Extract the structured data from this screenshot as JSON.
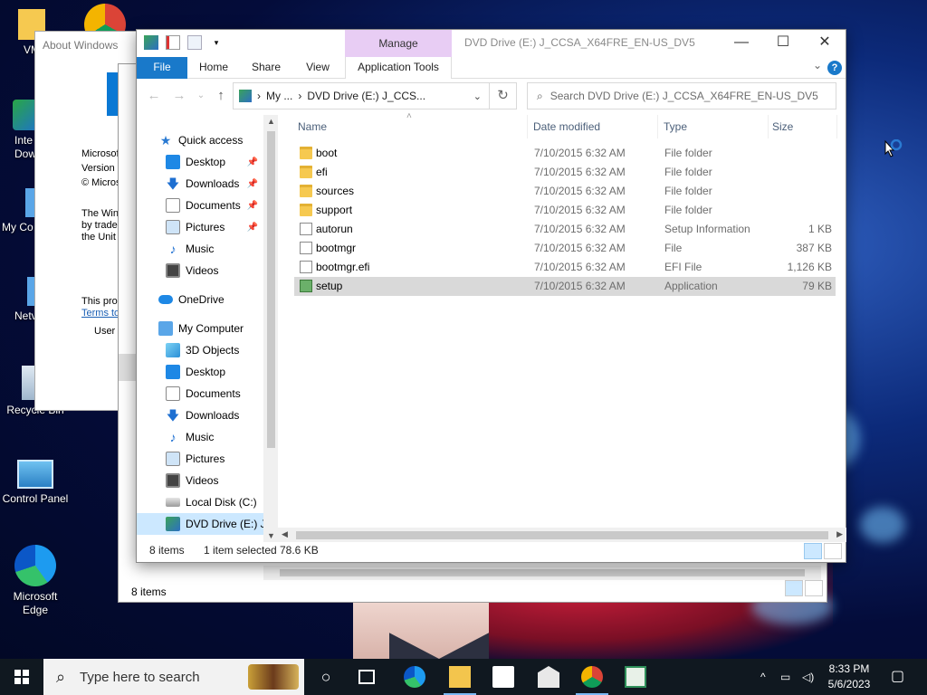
{
  "desktop": {
    "icons": [
      {
        "label": "VM"
      },
      {
        "label": "Inte Dow"
      },
      {
        "label": "My Co"
      },
      {
        "label": "Netv"
      },
      {
        "label": "Recycle Bin"
      },
      {
        "label": "Control Panel"
      },
      {
        "label": "Microsoft Edge"
      }
    ]
  },
  "about_window": {
    "title": "About Windows",
    "lines": [
      "Microsof",
      "Version",
      "© Micros",
      "The Win",
      "by trade",
      "the Unit",
      "This pro",
      "Terms to",
      "User"
    ]
  },
  "back_explorer": {
    "status": "8 items"
  },
  "explorer": {
    "manage_tab": "Manage",
    "window_title": "DVD Drive (E:) J_CCSA_X64FRE_EN-US_DV5",
    "controls": {
      "minimize": "—",
      "maximize": "☐",
      "close": "✕"
    },
    "ribbon_tabs": {
      "file": "File",
      "home": "Home",
      "share": "Share",
      "view": "View",
      "app_tools": "Application Tools"
    },
    "help": "?",
    "address": {
      "seg1": "My ...",
      "seg2": "DVD Drive (E:) J_CCS...",
      "sep": "›"
    },
    "search_placeholder": "Search DVD Drive (E:) J_CCSA_X64FRE_EN-US_DV5",
    "nav": {
      "quick_access": "Quick access",
      "qa_items": [
        "Desktop",
        "Downloads",
        "Documents",
        "Pictures",
        "Music",
        "Videos"
      ],
      "onedrive": "OneDrive",
      "my_computer": "My Computer",
      "pc_items": [
        "3D Objects",
        "Desktop",
        "Documents",
        "Downloads",
        "Music",
        "Pictures",
        "Videos",
        "Local Disk (C:)",
        "DVD Drive (E:) J_"
      ]
    },
    "columns": {
      "name": "Name",
      "date": "Date modified",
      "type": "Type",
      "size": "Size"
    },
    "files": [
      {
        "name": "boot",
        "date": "7/10/2015 6:32 AM",
        "type": "File folder",
        "size": "",
        "icon": "folder-icon"
      },
      {
        "name": "efi",
        "date": "7/10/2015 6:32 AM",
        "type": "File folder",
        "size": "",
        "icon": "folder-icon"
      },
      {
        "name": "sources",
        "date": "7/10/2015 6:32 AM",
        "type": "File folder",
        "size": "",
        "icon": "folder-icon"
      },
      {
        "name": "support",
        "date": "7/10/2015 6:32 AM",
        "type": "File folder",
        "size": "",
        "icon": "folder-icon"
      },
      {
        "name": "autorun",
        "date": "7/10/2015 6:32 AM",
        "type": "Setup Information",
        "size": "1 KB",
        "icon": "setup-info-icon"
      },
      {
        "name": "bootmgr",
        "date": "7/10/2015 6:32 AM",
        "type": "File",
        "size": "387 KB",
        "icon": "file-icon"
      },
      {
        "name": "bootmgr.efi",
        "date": "7/10/2015 6:32 AM",
        "type": "EFI File",
        "size": "1,126 KB",
        "icon": "file-icon"
      },
      {
        "name": "setup",
        "date": "7/10/2015 6:32 AM",
        "type": "Application",
        "size": "79 KB",
        "icon": "setup-app-icon"
      }
    ],
    "status": {
      "count": "8 items",
      "selected": "1 item selected",
      "size": "78.6 KB"
    }
  },
  "taskbar": {
    "search_placeholder": "Type here to search",
    "time": "8:33 PM",
    "date": "5/6/2023"
  },
  "colors": {
    "accent": "#1979ca",
    "manage": "#e8cdf4",
    "selected_row": "#d9d9d9",
    "nav_selected": "#cce8ff"
  }
}
